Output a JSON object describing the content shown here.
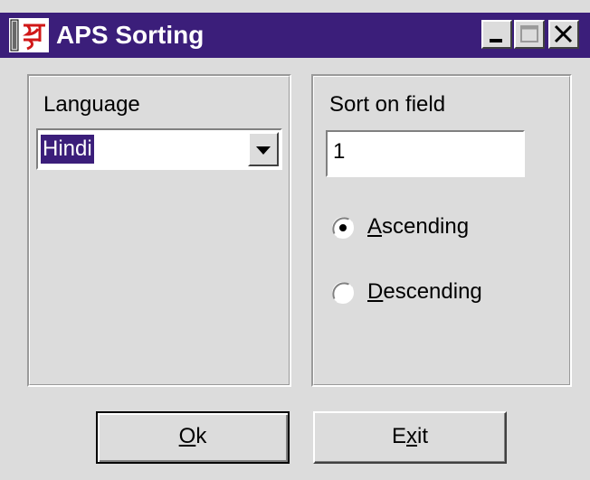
{
  "window": {
    "title": "APS Sorting"
  },
  "language_group": {
    "label": "Language",
    "selected": "Hindi"
  },
  "sort_group": {
    "label": "Sort on field",
    "field_value": "1",
    "order_options": [
      {
        "before": "",
        "accel": "A",
        "after": "scending",
        "checked": true
      },
      {
        "before": "",
        "accel": "D",
        "after": "escending",
        "checked": false
      }
    ]
  },
  "buttons": {
    "ok": {
      "before": "",
      "accel": "O",
      "after": "k"
    },
    "exit": {
      "before": "E",
      "accel": "x",
      "after": "it"
    }
  },
  "colors": {
    "titlebar": "#3b1e7a",
    "face": "#dcdcdc",
    "selection": "#3b1e7a",
    "icon_red": "#d01818"
  },
  "icons": {
    "app": "aps-app-icon",
    "minimize": "minimize-icon",
    "maximize": "maximize-icon",
    "close": "close-icon",
    "dropdown": "chevron-down-icon",
    "radio_on": "radio-selected-icon",
    "radio_off": "radio-unselected-icon"
  }
}
